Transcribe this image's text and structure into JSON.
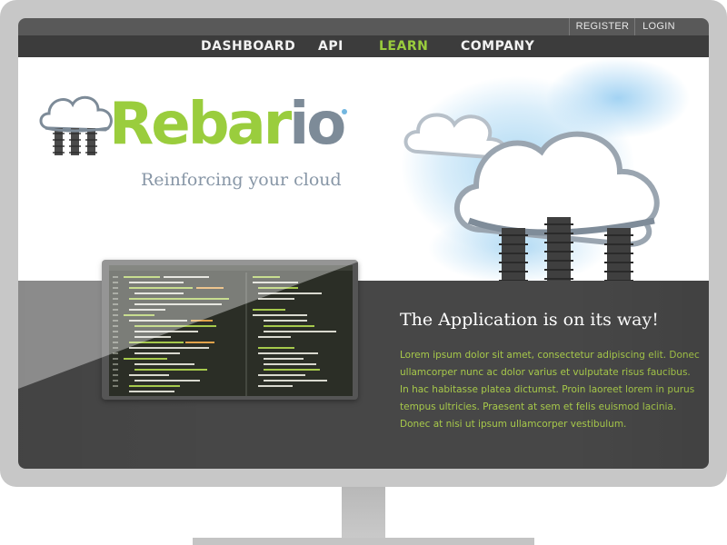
{
  "utility_nav": {
    "register": "REGISTER",
    "login": "LOGIN"
  },
  "main_nav": {
    "items": [
      {
        "label": "DASHBOARD"
      },
      {
        "label": "API"
      },
      {
        "label": "LEARN",
        "active": true
      },
      {
        "label": "COMPANY"
      }
    ]
  },
  "hero": {
    "logo_part1": "Rebar",
    "logo_part2": "io",
    "tagline": "Reinforcing your cloud"
  },
  "promo": {
    "heading": "The Application is on its way!",
    "body_lines": [
      "Lorem ipsum dolor sit amet, consectetur adipiscing elit. Donec",
      "ullamcorper nunc ac dolor varius et vulputate risus faucibus.",
      "In hac habitasse platea dictumst. Proin laoreet lorem in purus",
      "tempus ultricies. Praesent at sem et felis euismod lacinia.",
      "Donec at nisi ut ipsum ullamcorper vestibulum."
    ]
  },
  "colors": {
    "brand_green": "#9acd3d",
    "brand_gray": "#7d8b98",
    "nav_bg": "#3c3c3c",
    "dark_section_bg": "#474747",
    "body_text_green": "#a7c94a"
  },
  "icons": {
    "logo": "cloud-with-rebar-icon",
    "hero_art": "cloud-with-rebar-illustration"
  }
}
